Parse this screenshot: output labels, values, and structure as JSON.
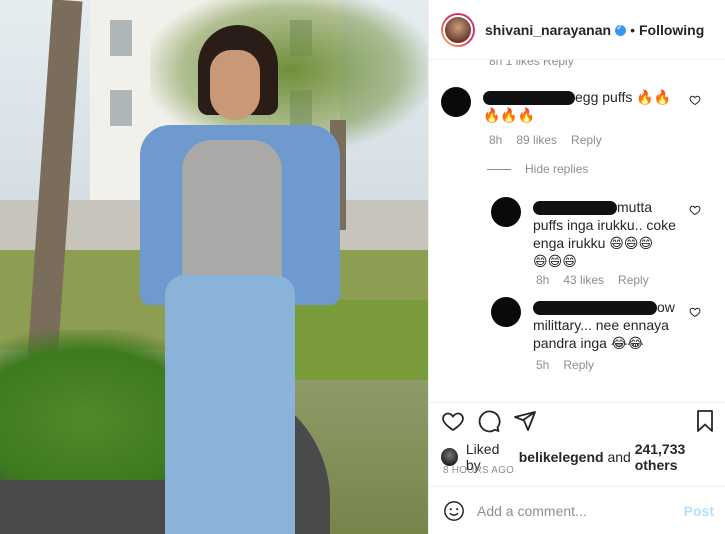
{
  "header": {
    "username": "shivani_narayanan",
    "separator": "•",
    "following_label": "Following",
    "verified": true
  },
  "comments_clipped_meta": "8h   1 likes   Reply",
  "comments": [
    {
      "author_redacted": true,
      "text_line1": "egg puffs 🔥🔥",
      "text_line2": "🔥🔥🔥",
      "time": "8h",
      "likes": "89 likes",
      "reply_label": "Reply"
    }
  ],
  "hide_replies_label": "Hide replies",
  "replies": [
    {
      "author_redacted": true,
      "text_line1": "mutta",
      "text_line2": "puffs inga irukku.. coke",
      "text_line3": "enga irukku 😄😄😄",
      "text_line4": "😄😄😄",
      "time": "8h",
      "likes": "43 likes",
      "reply_label": "Reply"
    },
    {
      "author_redacted": true,
      "text_line1": "ow",
      "text_line2": "milittary... nee ennaya",
      "text_line3": "pandra inga 😂😂",
      "time": "5h",
      "reply_label": "Reply"
    }
  ],
  "actions": {
    "like_icon": "heart-icon",
    "comment_icon": "comment-bubble-icon",
    "share_icon": "paper-plane-icon",
    "save_icon": "bookmark-icon"
  },
  "likes": {
    "prefix": "Liked by ",
    "user": "belikelegend",
    "middle": " and ",
    "count": "241,733 others"
  },
  "time_ago": "8 HOURS AGO",
  "add_comment": {
    "placeholder": "Add a comment...",
    "post_label": "Post",
    "emoji_icon": "smiley-icon"
  },
  "colors": {
    "verified_blue": "#3897f0",
    "post_disabled": "#b2dffc",
    "muted_text": "#8e8e8e"
  }
}
